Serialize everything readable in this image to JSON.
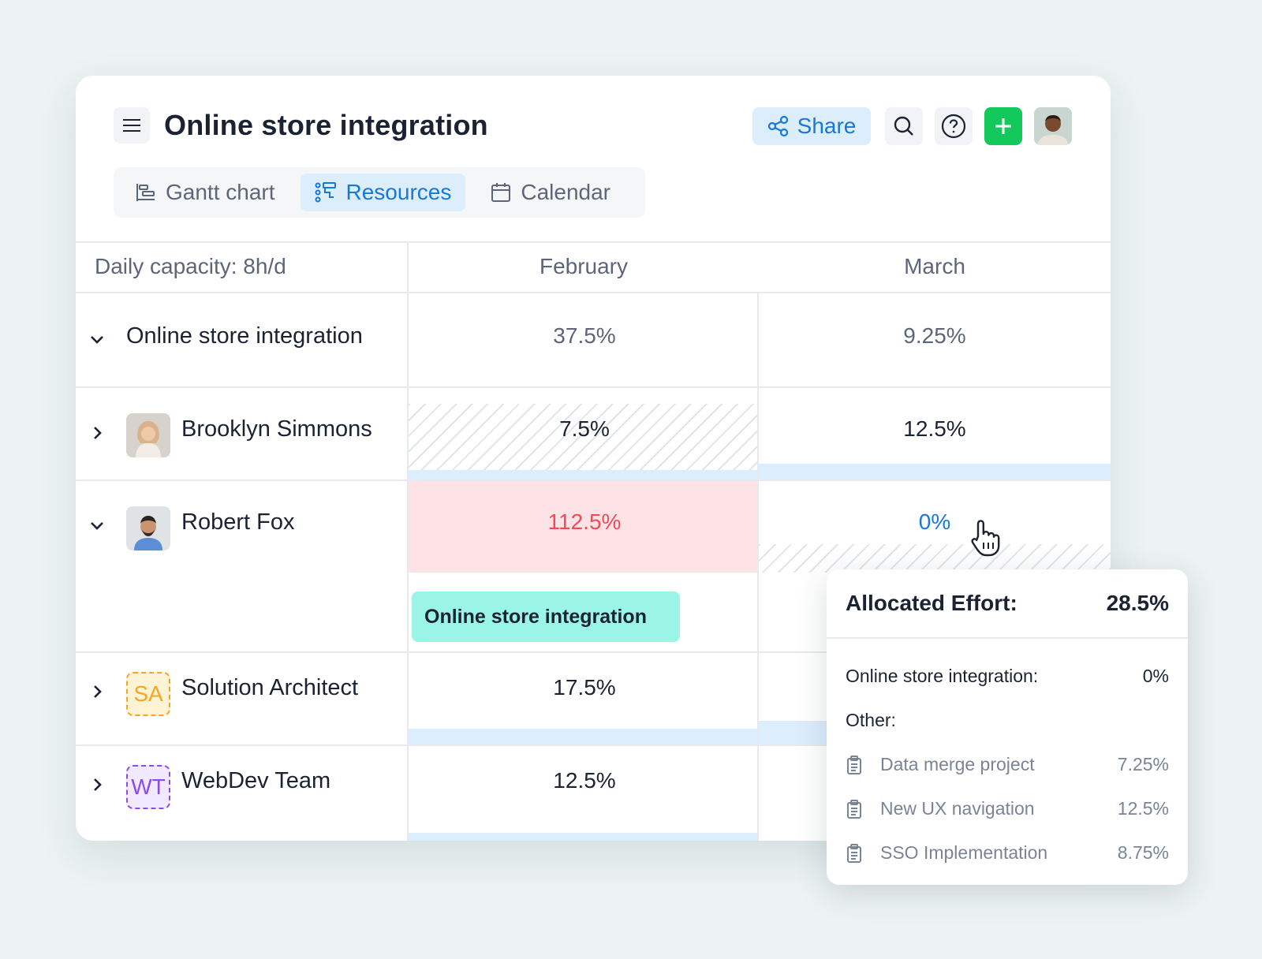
{
  "header": {
    "title": "Online store integration",
    "share_label": "Share",
    "icons": [
      "menu-icon",
      "share-icon",
      "search-icon",
      "help-icon",
      "plus-icon",
      "user-avatar"
    ]
  },
  "tabs": [
    {
      "label": "Gantt chart",
      "icon": "gantt-icon",
      "active": false
    },
    {
      "label": "Resources",
      "icon": "resources-icon",
      "active": true
    },
    {
      "label": "Calendar",
      "icon": "calendar-icon",
      "active": false
    }
  ],
  "grid": {
    "capacity_label": "Daily capacity: 8h/d",
    "months": [
      "February",
      "March"
    ],
    "rows": [
      {
        "name": "Online store integration",
        "expanded": true,
        "feb": "37.5%",
        "mar": "9.25%"
      },
      {
        "name": "Brooklyn Simmons",
        "expanded": false,
        "feb": "7.5%",
        "mar": "12.5%"
      },
      {
        "name": "Robert Fox",
        "expanded": true,
        "feb": "112.5%",
        "mar": "0%"
      },
      {
        "name": "Solution Architect",
        "badge": "SA",
        "expanded": false,
        "feb": "17.5%"
      },
      {
        "name": "WebDev Team",
        "badge": "WT",
        "expanded": false,
        "feb": "12.5%"
      }
    ],
    "task_bar": "Online store integration"
  },
  "popup": {
    "title": "Allocated Effort:",
    "total": "28.5%",
    "project_label": "Online store integration:",
    "project_value": "0%",
    "other_label": "Other:",
    "items": [
      {
        "name": "Data merge project",
        "value": "7.25%"
      },
      {
        "name": "New UX navigation",
        "value": "12.5%"
      },
      {
        "name": "SSO Implementation",
        "value": "8.75%"
      }
    ]
  },
  "colors": {
    "accent": "#1878d6",
    "accent_bg": "#dcedfb",
    "add": "#13c95b",
    "over_text": "#ef4a5a",
    "over_bg": "#fde3e6",
    "task": "#9af5e6",
    "sa": "#f5a623",
    "wt": "#8a4dea"
  }
}
